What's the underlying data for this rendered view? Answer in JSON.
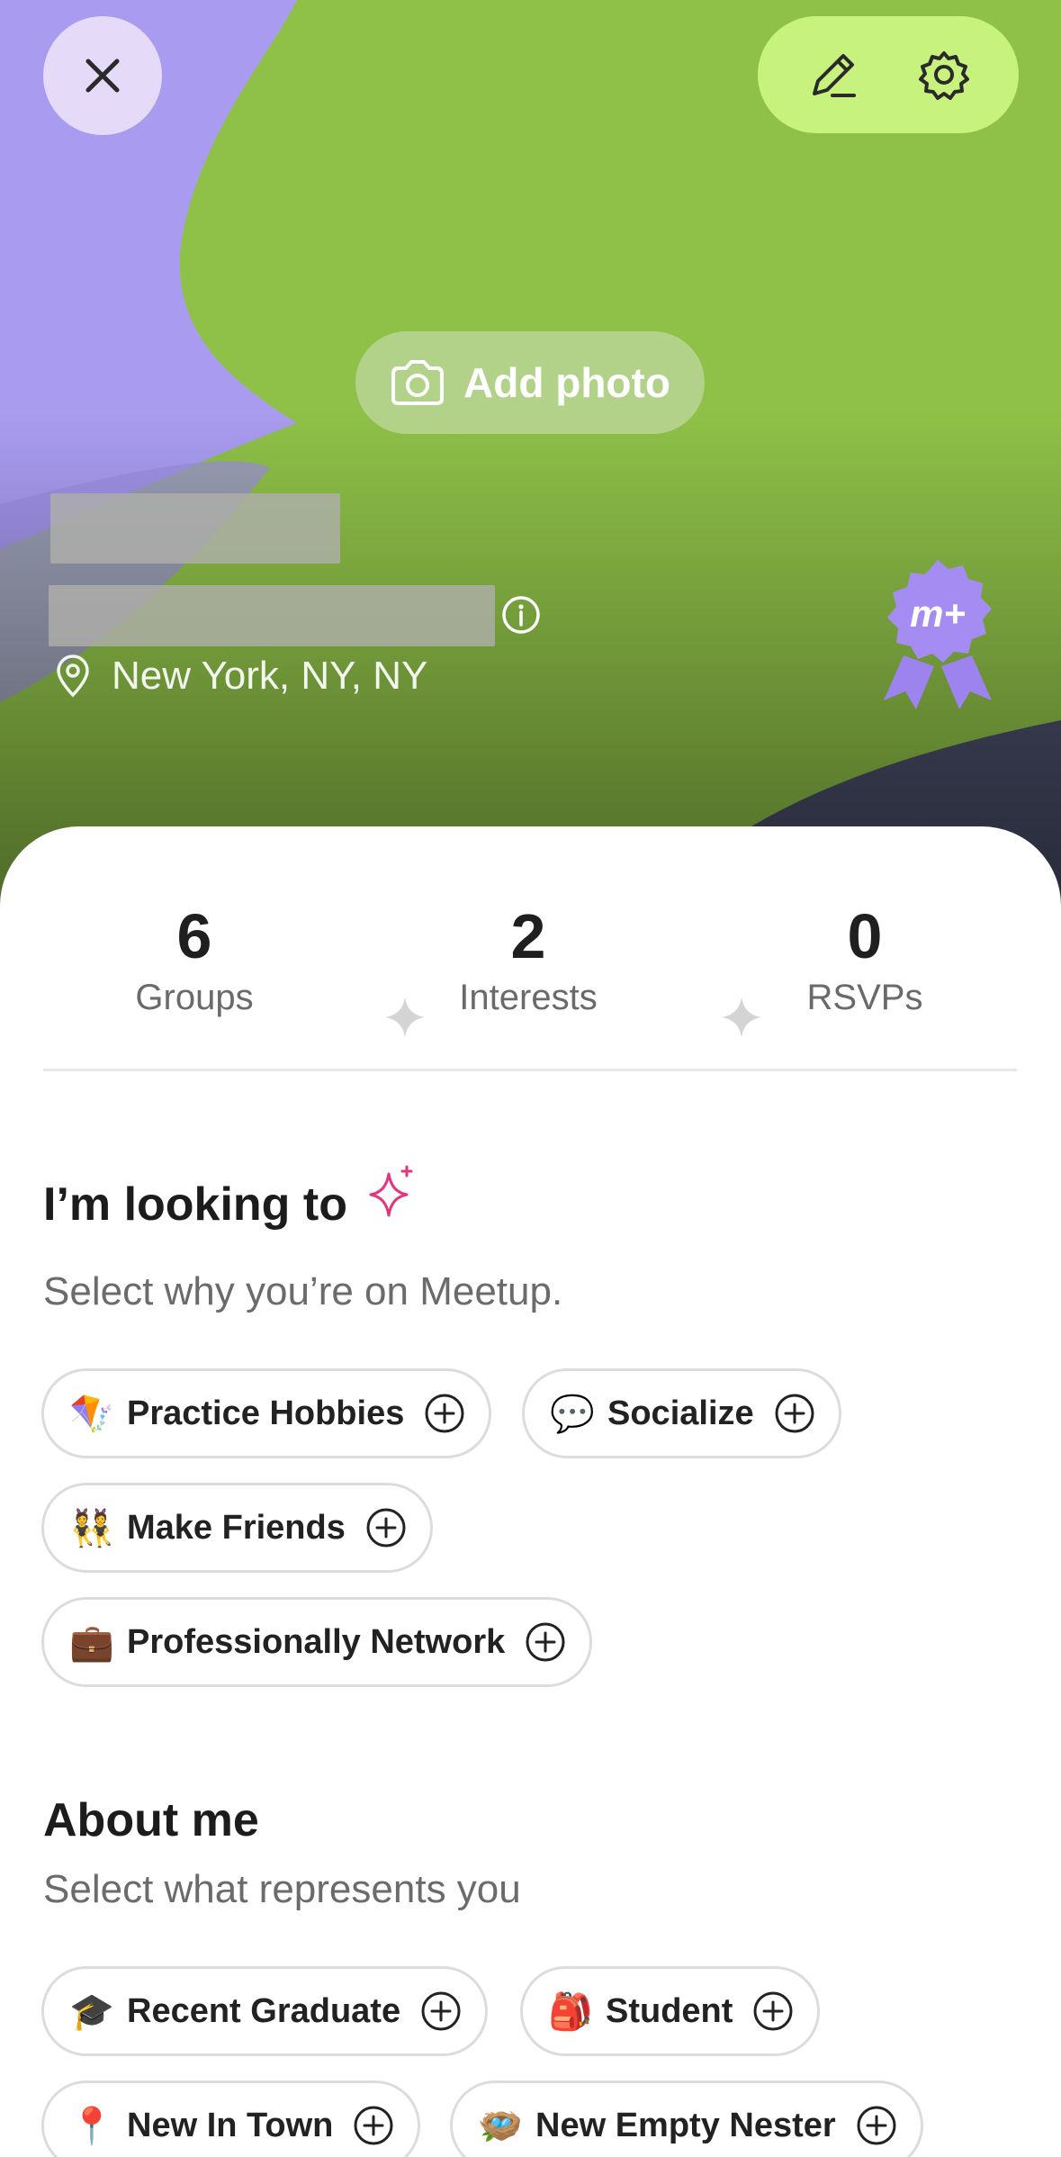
{
  "hero": {
    "close_icon": "close-icon",
    "edit_icon": "pencil-icon",
    "settings_icon": "gear-icon",
    "add_photo_label": "Add photo",
    "camera_icon": "camera-icon",
    "location": "New York, NY, NY",
    "badge_text": "m+",
    "colors": {
      "green": "#8fc148",
      "purple": "#a99cf0",
      "pill": "#c7f27d"
    }
  },
  "stats": [
    {
      "value": "6",
      "label": "Groups"
    },
    {
      "value": "2",
      "label": "Interests"
    },
    {
      "value": "0",
      "label": "RSVPs"
    }
  ],
  "looking": {
    "title": "I’m looking to",
    "subtitle": "Select why you’re on Meetup.",
    "chips": [
      {
        "emoji": "🪁",
        "label": "Practice Hobbies"
      },
      {
        "emoji": "💬",
        "label": "Socialize"
      },
      {
        "emoji": "👯",
        "label": "Make Friends"
      },
      {
        "emoji": "💼",
        "label": "Professionally Network"
      }
    ]
  },
  "about": {
    "title": "About me",
    "subtitle": "Select what represents you",
    "chips": [
      {
        "emoji": "🎓",
        "label": "Recent Graduate"
      },
      {
        "emoji": "🎒",
        "label": "Student"
      },
      {
        "emoji": "📍",
        "label": "New In Town"
      },
      {
        "emoji": "🪺",
        "label": "New Empty Nester"
      }
    ]
  }
}
